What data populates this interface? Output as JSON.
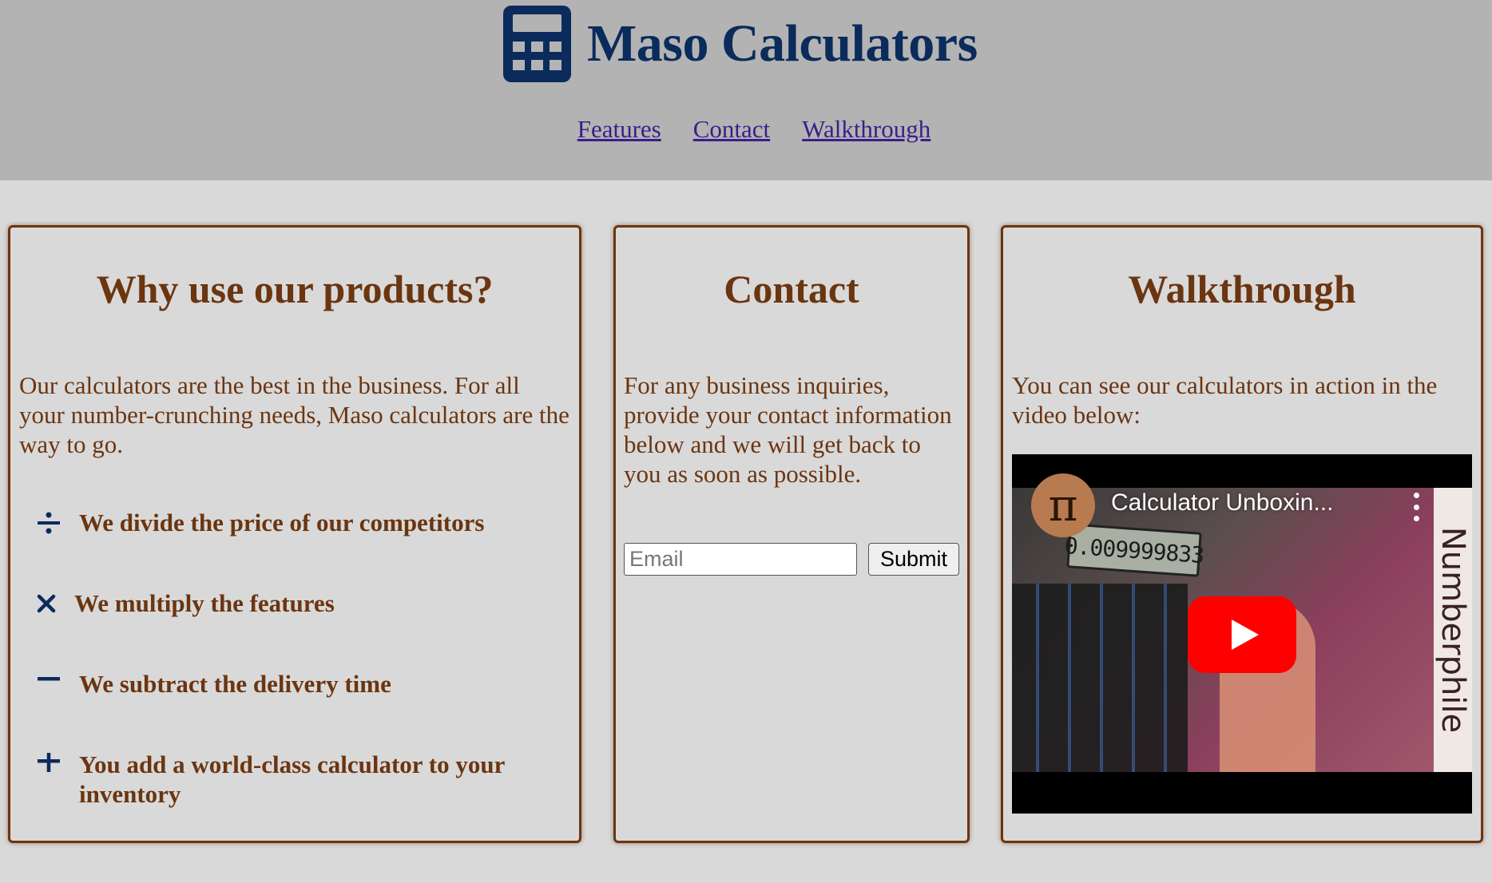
{
  "header": {
    "brand_title": "Maso Calculators",
    "logo_icon": "calculator-icon",
    "brand_color": "#0b2b5c",
    "nav": [
      {
        "label": "Features"
      },
      {
        "label": "Contact"
      },
      {
        "label": "Walkthrough"
      }
    ]
  },
  "features_card": {
    "heading": "Why use our products?",
    "intro": "Our calculators are the best in the business. For all your number-crunching needs, Maso calculators are the way to go.",
    "items": [
      {
        "icon": "divide-icon",
        "text": "We divide the price of our competitors"
      },
      {
        "icon": "multiply-icon",
        "text": "We multiply the features"
      },
      {
        "icon": "minus-icon",
        "text": "We subtract the delivery time"
      },
      {
        "icon": "plus-icon",
        "text": "You add a world-class calculator to your inventory"
      }
    ]
  },
  "contact_card": {
    "heading": "Contact",
    "text": "For any business inquiries, provide your contact information below and we will get back to you as soon as possible.",
    "email_placeholder": "Email",
    "email_value": "",
    "submit_label": "Submit"
  },
  "walkthrough_card": {
    "heading": "Walkthrough",
    "text": "You can see our calculators in action in the video below:",
    "video": {
      "title": "Calculator Unboxin...",
      "channel_avatar_glyph": "π",
      "display_reading": "0.009999833",
      "side_brand": "Numberphile",
      "play_color": "#ff0000"
    }
  },
  "colors": {
    "text_brown": "#6b3510",
    "header_bg": "#b3b3b3",
    "page_bg": "#d9d9d9",
    "link": "#3b1e8a"
  }
}
